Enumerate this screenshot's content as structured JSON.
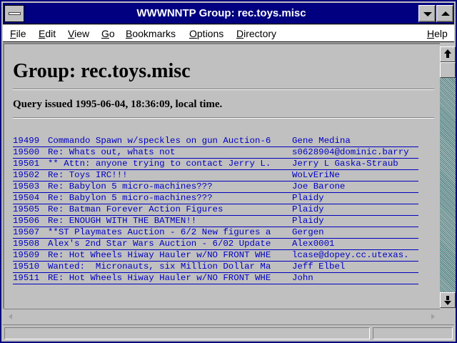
{
  "window": {
    "title": "WWWNNTP Group: rec.toys.misc"
  },
  "menu": {
    "items": [
      {
        "accel": "F",
        "rest": "ile"
      },
      {
        "accel": "E",
        "rest": "dit"
      },
      {
        "accel": "V",
        "rest": "iew"
      },
      {
        "accel": "G",
        "rest": "o"
      },
      {
        "accel": "B",
        "rest": "ookmarks"
      },
      {
        "accel": "O",
        "rest": "ptions"
      },
      {
        "accel": "D",
        "rest": "irectory"
      },
      {
        "accel": "H",
        "rest": "elp"
      }
    ]
  },
  "page": {
    "heading": "Group: rec.toys.misc",
    "query": "Query issued 1995-06-04, 18:36:09, local time.",
    "articles": [
      {
        "num": "19499",
        "subject": "Commando Spawn w/speckles on gun Auction-6",
        "author": "Gene Medina"
      },
      {
        "num": "19500",
        "subject": "Re: Whats out, whats not",
        "author": "s0628904@dominic.barry"
      },
      {
        "num": "19501",
        "subject": "** Attn: anyone trying to contact Jerry L.",
        "author": "Jerry L Gaska-Straub"
      },
      {
        "num": "19502",
        "subject": "Re: Toys IRC!!!",
        "author": "WoLvEriNe"
      },
      {
        "num": "19503",
        "subject": "Re: Babylon 5 micro-machines???",
        "author": "Joe Barone"
      },
      {
        "num": "19504",
        "subject": "Re: Babylon 5 micro-machines???",
        "author": "Plaidy"
      },
      {
        "num": "19505",
        "subject": "Re: Batman Forever Action Figures",
        "author": "Plaidy"
      },
      {
        "num": "19506",
        "subject": "Re: ENOUGH WITH THE BATMEN!!",
        "author": "Plaidy"
      },
      {
        "num": "19507",
        "subject": "**ST Playmates Auction - 6/2 New figures a",
        "author": "Gergen"
      },
      {
        "num": "19508",
        "subject": "Alex's 2nd Star Wars Auction - 6/02 Update",
        "author": "Alex0001"
      },
      {
        "num": "19509",
        "subject": "Re: Hot Wheels Hiway Hauler w/NO FRONT WHE",
        "author": "lcase@dopey.cc.utexas."
      },
      {
        "num": "19510",
        "subject": "Wanted:  Micronauts, six Million Dollar Ma",
        "author": "Jeff Elbel"
      },
      {
        "num": "19511",
        "subject": "RE: Hot Wheels Hiway Hauler w/NO FRONT WHE",
        "author": "John"
      }
    ]
  },
  "status": {
    "text": ""
  },
  "colors": {
    "titlebar": "#000080",
    "link": "#0000c0",
    "face": "#c0c0c0"
  }
}
